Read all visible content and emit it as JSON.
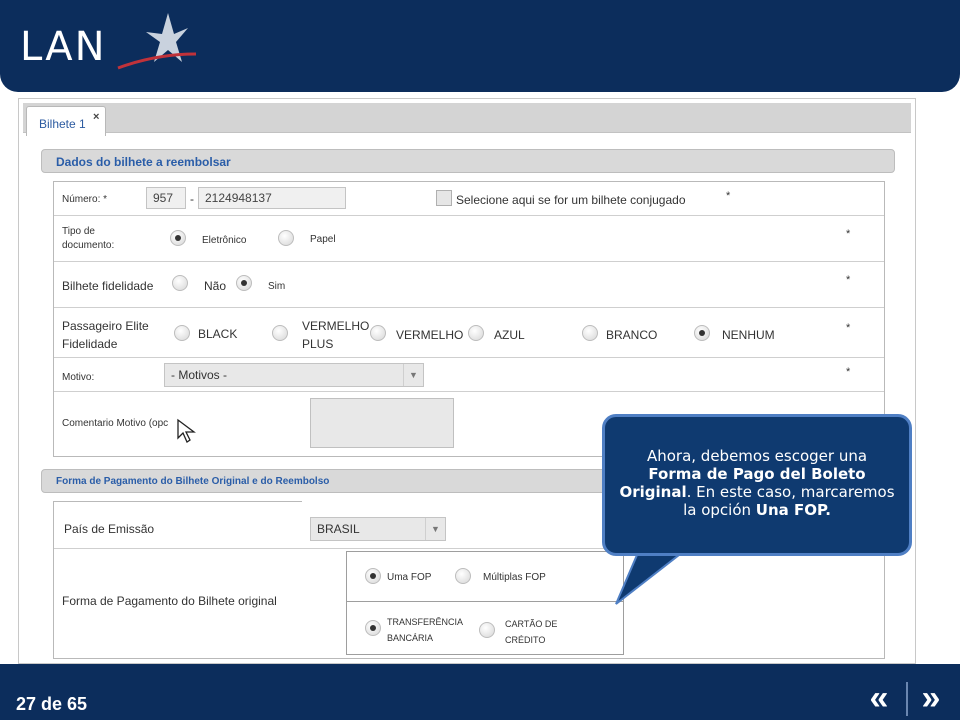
{
  "header": {
    "logo_text": "LAN"
  },
  "tabs": [
    {
      "label": "Bilhete 1",
      "close": "×"
    }
  ],
  "section1": {
    "title": "Dados do bilhete a reembolsar"
  },
  "numero": {
    "label": "Número: *",
    "prefix": "957",
    "dash": "-",
    "ticket": "2124948137",
    "checkbox_label": "Selecione aqui se for um bilhete conjugado",
    "asterisk": "*"
  },
  "tipo_documento": {
    "label_line1": "Tipo de",
    "label_line2": "documento:",
    "options": [
      "Eletrônico",
      "Papel"
    ],
    "selected": "Eletrônico",
    "asterisk": "*"
  },
  "fidelidade": {
    "label": "Bilhete fidelidade",
    "options": [
      "Não",
      "Sim"
    ],
    "selected": "Sim",
    "asterisk": "*"
  },
  "elite": {
    "label_line1": "Passageiro Elite",
    "label_line2": "Fidelidade",
    "options": [
      "BLACK",
      "VERMELHO PLUS",
      "VERMELHO",
      "AZUL",
      "BRANCO",
      "NENHUM"
    ],
    "option_vplus_line1": "VERMELHO",
    "option_vplus_line2": "PLUS",
    "selected": "NENHUM",
    "asterisk": "*"
  },
  "motivo": {
    "label": "Motivo:",
    "value": "- Motivos -",
    "asterisk": "*"
  },
  "comentario": {
    "label": "Comentario Motivo (opc"
  },
  "section2": {
    "title": "Forma de Pagamento do Bilhete Original e do Reembolso"
  },
  "pais": {
    "label": "País de Emissão",
    "value": "BRASIL"
  },
  "forma_pagamento": {
    "label": "Forma de Pagamento do Bilhete original",
    "fop_options": [
      "Uma FOP",
      "Múltiplas FOP"
    ],
    "fop_selected": "Uma FOP",
    "type_options": [
      {
        "line1": "TRANSFERÊNCIA",
        "line2": "BANCÁRIA"
      },
      {
        "line1": "CARTÃO DE",
        "line2": "CRÉDITO"
      }
    ],
    "type_selected": "TRANSFERÊNCIA BANCÁRIA"
  },
  "callout": {
    "t1": "Ahora, debemos escoger una ",
    "b1": "Forma de Pago del Boleto Original",
    "t2": ". En este caso, marcaremos la opción ",
    "b2": "Una FOP.",
    "bg": "#0f3a70"
  },
  "footer": {
    "page": "27 de 65",
    "prev": "«",
    "next": "»"
  },
  "colors": {
    "brand_navy": "#0c2d5c",
    "link_blue": "#2a5da8"
  }
}
